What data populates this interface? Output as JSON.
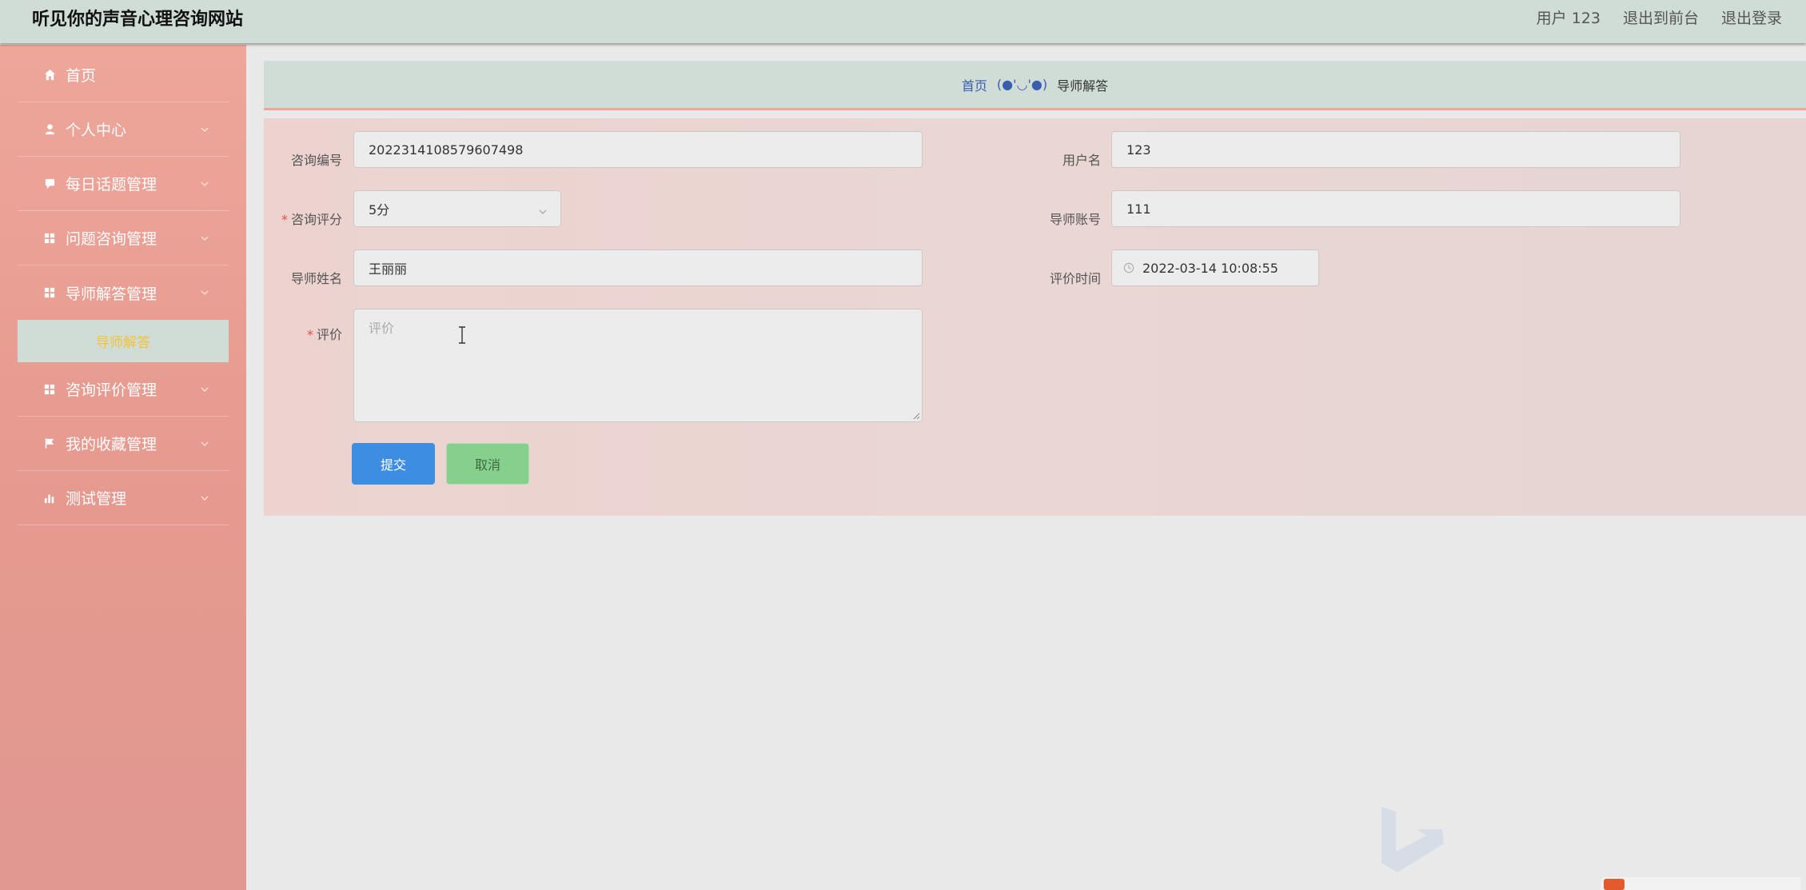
{
  "header": {
    "site_title": "听见你的声音心理咨询网站",
    "user_label": "用户 123",
    "to_front": "退出到前台",
    "logout": "退出登录"
  },
  "sidebar": {
    "items": [
      {
        "label": "首页",
        "icon": "home-icon"
      },
      {
        "label": "个人中心",
        "icon": "user-icon"
      },
      {
        "label": "每日话题管理",
        "icon": "chat-icon"
      },
      {
        "label": "问题咨询管理",
        "icon": "grid-icon"
      },
      {
        "label": "导师解答管理",
        "icon": "grid-icon"
      },
      {
        "label": "咨询评价管理",
        "icon": "grid-icon"
      },
      {
        "label": "我的收藏管理",
        "icon": "flag-icon"
      },
      {
        "label": "测试管理",
        "icon": "bar-chart-icon"
      }
    ],
    "active_submenu": "导师解答"
  },
  "breadcrumb": {
    "home": "首页",
    "separator": "(●'◡'●)",
    "current": "导师解答"
  },
  "form": {
    "consult_no_label": "咨询编号",
    "consult_no_value": "2022314108579607498",
    "username_label": "用户名",
    "username_value": "123",
    "rating_label": "咨询评分",
    "rating_value": "5分",
    "mentor_account_label": "导师账号",
    "mentor_account_value": "111",
    "mentor_name_label": "导师姓名",
    "mentor_name_value": "王丽丽",
    "eval_time_label": "评价时间",
    "eval_time_value": "2022-03-14 10:08:55",
    "comment_label": "评价",
    "comment_placeholder": "评价",
    "submit": "提交",
    "cancel": "取消"
  },
  "colors": {
    "topbar": "#cfddd6",
    "sidebar": "#eea69a",
    "submit": "#3d8ee3",
    "cancel": "#86d08e",
    "active_submenu_text": "#f3c23a"
  }
}
